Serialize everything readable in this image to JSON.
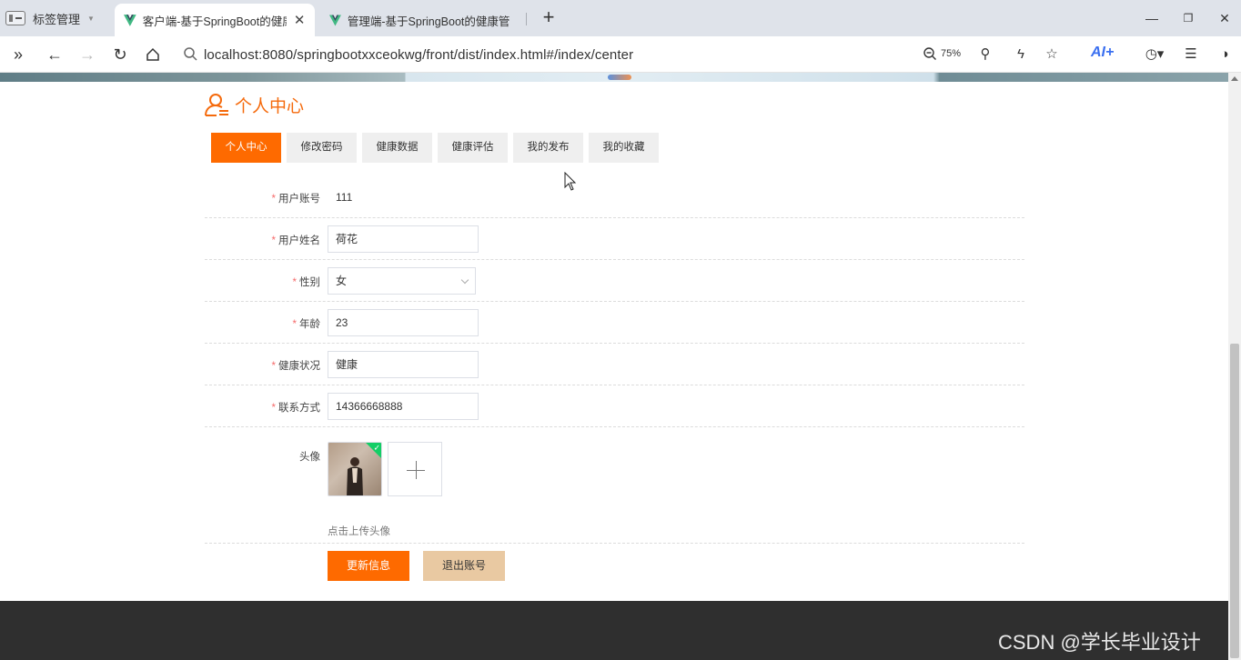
{
  "browser": {
    "tab_manager_label": "标签管理",
    "tabs": [
      {
        "title": "客户端-基于SpringBoot的健康",
        "active": true
      },
      {
        "title": "管理端-基于SpringBoot的健康管",
        "active": false
      }
    ],
    "url": "localhost:8080/springbootxxceokwg/front/dist/index.html#/index/center",
    "zoom": "75%",
    "ai_label": "AI+"
  },
  "page": {
    "title": "个人中心",
    "tabs": [
      "个人中心",
      "修改密码",
      "健康数据",
      "健康评估",
      "我的发布",
      "我的收藏"
    ],
    "active_tab": "个人中心"
  },
  "form": {
    "account": {
      "label": "用户账号",
      "value": "111"
    },
    "name": {
      "label": "用户姓名",
      "value": "荷花"
    },
    "gender": {
      "label": "性别",
      "value": "女"
    },
    "age": {
      "label": "年龄",
      "value": "23"
    },
    "health": {
      "label": "健康状况",
      "value": "健康"
    },
    "contact": {
      "label": "联系方式",
      "value": "14366668888"
    },
    "avatar": {
      "label": "头像",
      "hint": "点击上传头像"
    },
    "required_mark": "*"
  },
  "actions": {
    "update": "更新信息",
    "logout": "退出账号"
  },
  "watermark": "CSDN @学长毕业设计",
  "colors": {
    "accent": "#fe6a00",
    "logout_button": "#e9c9a2",
    "footer": "#2f2f2f",
    "required": "#f56c6c"
  }
}
